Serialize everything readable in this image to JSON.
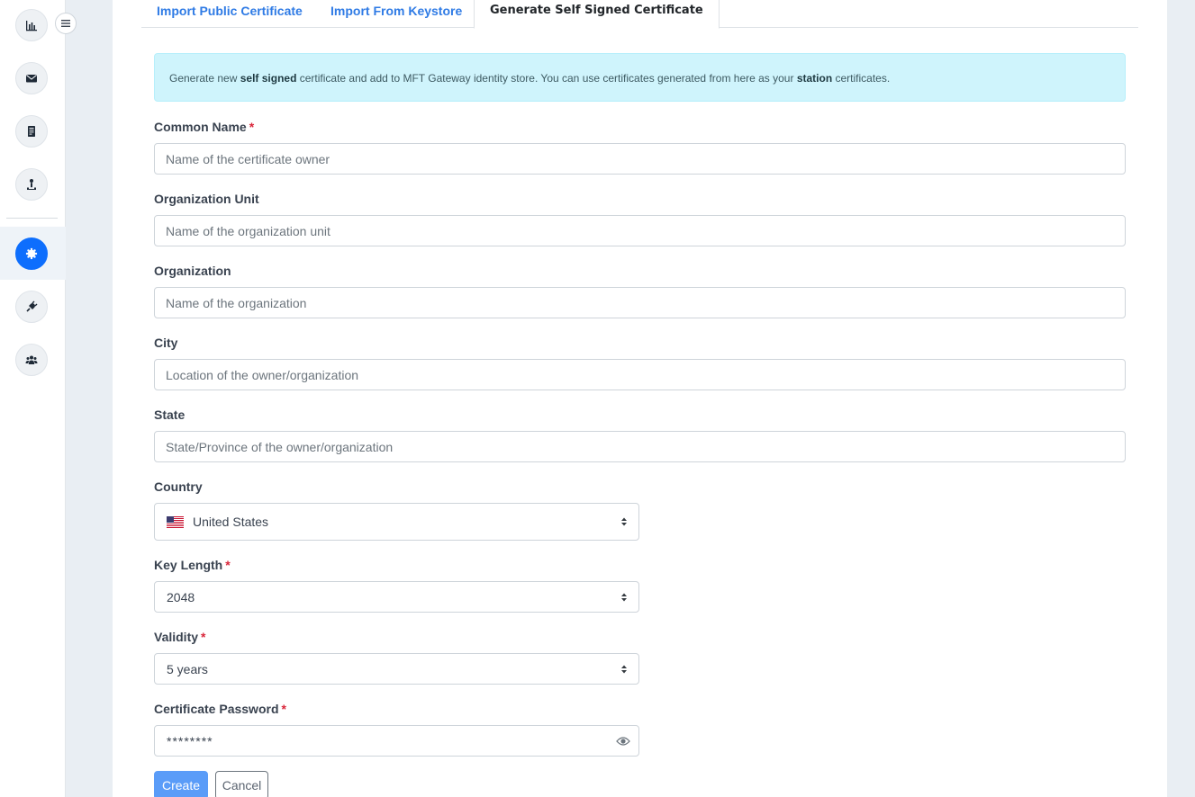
{
  "sidebar": {
    "items": [
      {
        "icon": "bar-chart-icon"
      },
      {
        "icon": "envelope-icon"
      },
      {
        "icon": "document-icon"
      },
      {
        "icon": "person-upload-icon"
      },
      {
        "icon": "certificate-icon",
        "active": true
      },
      {
        "icon": "plug-icon"
      },
      {
        "icon": "users-icon"
      }
    ],
    "toggle_icon": "hamburger-icon",
    "accent": "#0d6efd"
  },
  "tabs": [
    {
      "label": "Import Public Certificate"
    },
    {
      "label": "Import From Keystore"
    },
    {
      "label": "Generate Self Signed Certificate",
      "active": true
    }
  ],
  "alert": {
    "part1": "Generate new ",
    "bold1": "self signed",
    "part2": " certificate and add to MFT Gateway identity store. You can use certificates generated from here as your ",
    "bold2": "station",
    "part3": " certificates."
  },
  "form": {
    "common_name": {
      "label": "Common Name",
      "required": "*",
      "placeholder": "Name of the certificate owner"
    },
    "org_unit": {
      "label": "Organization Unit",
      "placeholder": "Name of the organization unit"
    },
    "organization": {
      "label": "Organization",
      "placeholder": "Name of the organization"
    },
    "city": {
      "label": "City",
      "placeholder": "Location of the owner/organization"
    },
    "state": {
      "label": "State",
      "placeholder": "State/Province of the owner/organization"
    },
    "country": {
      "label": "Country",
      "value": "United States",
      "flag": "us-flag-icon"
    },
    "key_length": {
      "label": "Key Length",
      "required": "*",
      "value": "2048"
    },
    "validity": {
      "label": "Validity",
      "required": "*",
      "value": "5 years"
    },
    "password": {
      "label": "Certificate Password",
      "required": "*",
      "value": "********"
    },
    "create_label": "Create",
    "cancel_label": "Cancel"
  }
}
